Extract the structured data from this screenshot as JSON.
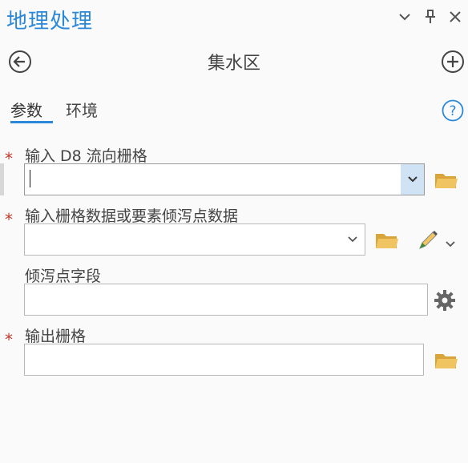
{
  "pane": {
    "title": "地理处理"
  },
  "tool": {
    "title": "集水区"
  },
  "tabs": [
    {
      "label": "参数",
      "active": true
    },
    {
      "label": "环境",
      "active": false
    }
  ],
  "params": [
    {
      "label": "输入 D8 流向栅格",
      "required": true,
      "value": ""
    },
    {
      "label": "输入栅格数据或要素倾泻点数据",
      "required": true,
      "value": ""
    },
    {
      "label": "倾泻点字段",
      "required": false,
      "value": ""
    },
    {
      "label": "输出栅格",
      "required": true,
      "value": ""
    }
  ],
  "required_mark": "*",
  "icons": {
    "back": "arrow-left-circle-icon",
    "add": "plus-circle-icon",
    "help": "question-circle-icon",
    "folder": "folder-icon",
    "pencil": "pencil-icon",
    "gear": "gear-icon",
    "dropdown": "chevron-down-icon",
    "pin": "pin-icon",
    "close": "close-icon"
  },
  "colors": {
    "accent": "#2b88d8",
    "required": "#c0392b",
    "folder": "#e6b64a",
    "dropdown_active_bg": "#cfe3f4"
  }
}
